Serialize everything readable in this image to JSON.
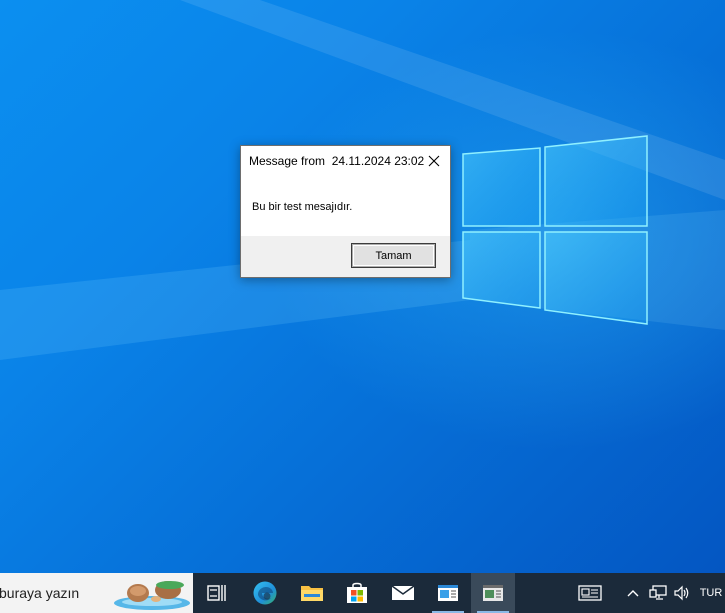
{
  "dialog": {
    "title": "Message from  24.11.2024 23:02",
    "message": "Bu bir test mesajıdır.",
    "ok_label": "Tamam"
  },
  "taskbar": {
    "search_placeholder": "buraya yazın",
    "apps": [
      {
        "name": "task-view",
        "icon": "task-view-icon"
      },
      {
        "name": "edge",
        "icon": "edge-icon"
      },
      {
        "name": "file-explorer",
        "icon": "folder-icon"
      },
      {
        "name": "microsoft-store",
        "icon": "store-icon"
      },
      {
        "name": "mail",
        "icon": "mail-icon"
      },
      {
        "name": "app-window-1",
        "icon": "app-window-icon",
        "running": true
      },
      {
        "name": "app-window-2",
        "icon": "app-window-icon",
        "active": true
      }
    ],
    "tray": {
      "news_icon": "news-icon",
      "chevron_icon": "chevron-up-icon",
      "network_icon": "network-icon",
      "volume_icon": "volume-icon",
      "language": "TUR"
    }
  },
  "colors": {
    "wallpaper": "#0a7fe6",
    "taskbar": "#1b2a3a",
    "accent": "#0078d7"
  }
}
